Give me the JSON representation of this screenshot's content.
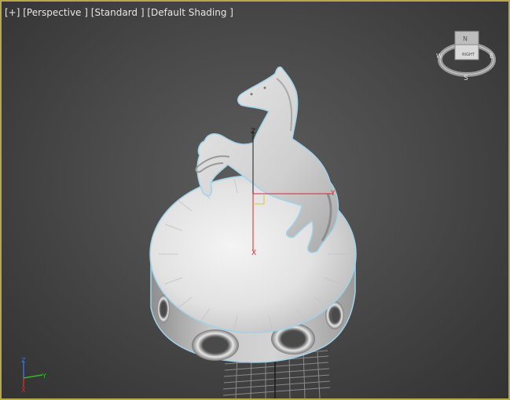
{
  "viewport": {
    "menu_plus": "[+]",
    "view_perspective": "[Perspective ]",
    "view_standard": "[Standard ]",
    "view_shading": "[Default Shading ]",
    "border_color": "#b9a84a"
  },
  "viewcube": {
    "face_label": "RIGHT",
    "compass_labels": [
      "S",
      "W",
      "N",
      "E"
    ]
  },
  "gizmo": {
    "axis_x": "X",
    "axis_z": "Z",
    "axis_y": "Y"
  },
  "tripod": {
    "x_label": "X",
    "y_label": "Y",
    "z_label": "Z"
  },
  "colors": {
    "x_axis": "#d22c2c",
    "y_axis": "#3ab33a",
    "z_axis": "#3a6fd8",
    "selection_highlight": "#9fd3ea"
  },
  "scene": {
    "object": "horse statue on cylindrical pedestal",
    "grid": true
  }
}
